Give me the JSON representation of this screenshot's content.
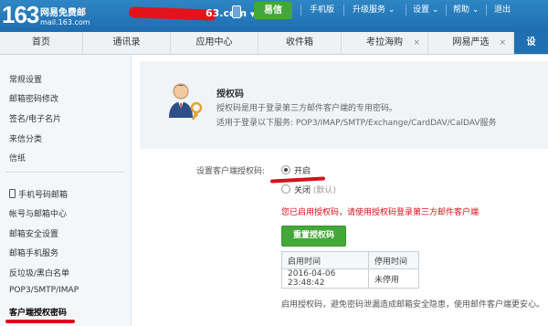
{
  "topbar": {
    "logo_number": "163",
    "logo_text": "网易免费邮",
    "logo_domain": "mail.163.com",
    "account_suffix": "63.com",
    "account_arrow": "▼",
    "yixin_label": "易信",
    "nav": [
      "手机版",
      "升级服务",
      "设置",
      "帮助",
      "退出"
    ],
    "nav_arrow": "⌄"
  },
  "tabs": [
    {
      "label": "首页",
      "closable": false
    },
    {
      "label": "通讯录",
      "closable": false
    },
    {
      "label": "应用中心",
      "closable": false
    },
    {
      "label": "收件箱",
      "closable": false
    },
    {
      "label": "考拉海购",
      "closable": true
    },
    {
      "label": "网易严选",
      "closable": true
    },
    {
      "label": "设",
      "closable": false,
      "active": true
    }
  ],
  "tab_close_symbol": "×",
  "sidebar": {
    "group1": [
      "常规设置",
      "邮箱密码修改",
      "签名/电子名片",
      "来信分类",
      "信纸"
    ],
    "group2": [
      "手机号码邮箱",
      "帐号与邮箱中心",
      "邮箱安全设置",
      "邮箱手机服务",
      "反垃圾/黑白名单",
      "POP3/SMTP/IMAP",
      "客户端授权密码"
    ]
  },
  "main": {
    "title": "授权码",
    "description": "授权码是用于登录第三方邮件客户端的专用密码。",
    "services": "适用于登录以下服务: POP3/IMAP/SMTP/Exchange/CardDAV/CalDAV服务",
    "form_label": "设置客户端授权码:",
    "option_on": "开启",
    "option_off": "关闭",
    "option_off_hint": "(默认)",
    "notice": "您已启用授权码，请使用授权码登录第三方邮件客户端",
    "reset_button": "重置授权码",
    "table_headers": [
      "启用时间",
      "停用时间"
    ],
    "table_row": [
      "2016-04-06 23:48:42",
      "未停用"
    ],
    "footnote": "启用授权码，避免密码泄漏造成邮箱安全隐患，使用邮件客户端更安心。"
  },
  "colors": {
    "topbar": "#1d6db0",
    "active_tab": "#1f6fb2",
    "button_green": "#44a838",
    "notice_red": "#d6101a"
  }
}
